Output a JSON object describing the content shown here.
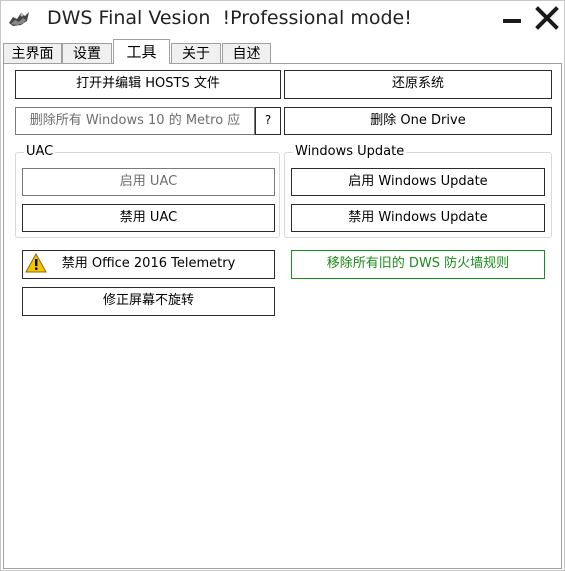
{
  "window": {
    "title": "DWS Final Vesion  !Professional mode!"
  },
  "tabs": [
    {
      "label": "主界面"
    },
    {
      "label": "设置"
    },
    {
      "label": "工具",
      "active": true
    },
    {
      "label": "关于"
    },
    {
      "label": "自述"
    }
  ],
  "tools": {
    "edit_hosts": "打开并编辑 HOSTS 文件",
    "restore_system": "还原系统",
    "remove_metro": "删除所有 Windows 10 的 Metro 应",
    "help": "?",
    "remove_onedrive": "删除 One Drive",
    "uac_group": "UAC",
    "enable_uac": "启用 UAC",
    "disable_uac": "禁用 UAC",
    "wu_group": "Windows Update",
    "enable_wu": "启用 Windows Update",
    "disable_wu": "禁用 Windows Update",
    "disable_office_telemetry": "禁用 Office 2016 Telemetry",
    "remove_firewall_rules": "移除所有旧的 DWS 防火墙规则",
    "fix_screen_rotation": "修正屏幕不旋转"
  },
  "icons": {
    "app": "dws-app-icon",
    "minimize": "minimize-icon",
    "close": "close-icon",
    "warning": "warning-icon"
  },
  "colors": {
    "green_text": "#1a8c1a",
    "disabled_text": "#6d6d6d"
  }
}
